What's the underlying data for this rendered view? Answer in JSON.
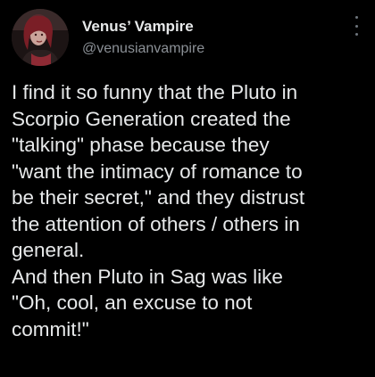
{
  "author": {
    "display_name": "Venus’ Vampire",
    "handle": "@venusianvampire",
    "avatar_icon": "profile-photo",
    "more_icon": "vertical-ellipsis-icon"
  },
  "tweet": {
    "lines": [
      "I find it so funny that the Pluto in",
      "Scorpio Generation created the",
      "\"talking\" phase because they",
      "\"want the intimacy of romance to",
      "be their secret,\" and they distrust",
      "the attention of others / others in",
      "general.",
      "And then Pluto in Sag was like",
      "\"Oh, cool, an excuse to not",
      "commit!\""
    ]
  },
  "colors": {
    "background": "#000000",
    "text_primary": "#e7e9ea",
    "text_secondary": "#8b9096"
  }
}
